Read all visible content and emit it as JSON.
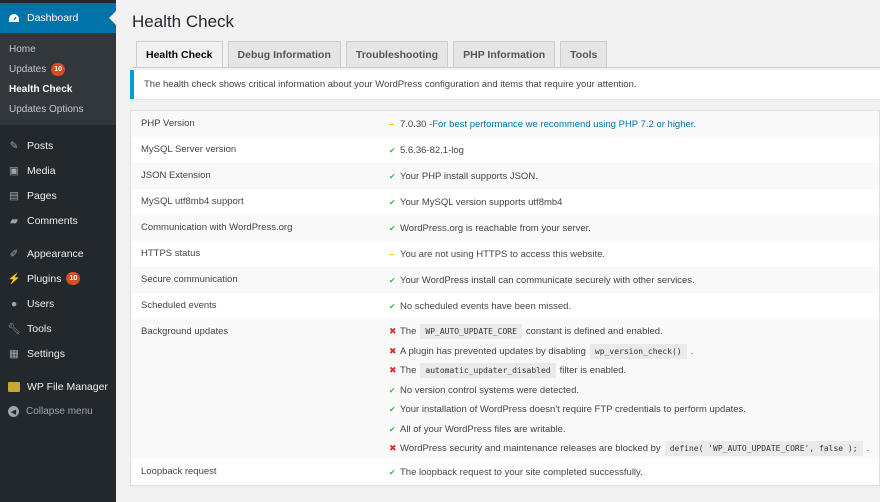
{
  "sidebar": {
    "dashboard": "Dashboard",
    "submenu": [
      {
        "label": "Home"
      },
      {
        "label": "Updates",
        "badge": "10"
      },
      {
        "label": "Health Check",
        "current": true
      },
      {
        "label": "Updates Options"
      }
    ],
    "items": [
      {
        "label": "Posts",
        "icon": "pin-icon"
      },
      {
        "label": "Media",
        "icon": "media-icon"
      },
      {
        "label": "Pages",
        "icon": "pages-icon"
      },
      {
        "label": "Comments",
        "icon": "comment-icon"
      },
      {
        "label": "Appearance",
        "icon": "brush-icon"
      },
      {
        "label": "Plugins",
        "icon": "plugin-icon",
        "badge": "10"
      },
      {
        "label": "Users",
        "icon": "user-icon"
      },
      {
        "label": "Tools",
        "icon": "wrench-icon"
      },
      {
        "label": "Settings",
        "icon": "settings-icon"
      },
      {
        "label": "WP File Manager",
        "icon": "folder-icon"
      }
    ],
    "collapse": "Collapse menu"
  },
  "page": {
    "title": "Health Check",
    "tabs": [
      "Health Check",
      "Debug Information",
      "Troubleshooting",
      "PHP Information",
      "Tools"
    ],
    "notice": "The health check shows critical information about your WordPress configuration and items that require your attention."
  },
  "checks": [
    {
      "label": "PHP Version",
      "status": "warning",
      "value": "7.0.30 - ",
      "link": "For best performance we recommend using PHP 7.2 or higher."
    },
    {
      "label": "MySQL Server version",
      "status": "good",
      "value": "5.6.36-82.1-log"
    },
    {
      "label": "JSON Extension",
      "status": "good",
      "value": "Your PHP install supports JSON."
    },
    {
      "label": "MySQL utf8mb4 support",
      "status": "good",
      "value": "Your MySQL version supports utf8mb4"
    },
    {
      "label": "Communication with WordPress.org",
      "status": "good",
      "value": "WordPress.org is reachable from your server."
    },
    {
      "label": "HTTPS status",
      "status": "warning",
      "value": "You are not using HTTPS to access this website."
    },
    {
      "label": "Secure communication",
      "status": "good",
      "value": "Your WordPress install can communicate securely with other services."
    },
    {
      "label": "Scheduled events",
      "status": "good",
      "value": "No scheduled events have been missed."
    }
  ],
  "background_updates": {
    "label": "Background updates",
    "lines": [
      {
        "status": "error",
        "pre": "The",
        "code": "WP_AUTO_UPDATE_CORE",
        "post": "constant is defined and enabled."
      },
      {
        "status": "error",
        "pre": "A plugin has prevented updates by disabling",
        "code": "wp_version_check()",
        "post": "."
      },
      {
        "status": "error",
        "pre": "The",
        "code": "automatic_updater_disabled",
        "post": "filter is enabled."
      },
      {
        "status": "good",
        "pre": "No version control systems were detected."
      },
      {
        "status": "good",
        "pre": "Your installation of WordPress doesn't require FTP credentials to perform updates."
      },
      {
        "status": "good",
        "pre": "All of your WordPress files are writable."
      },
      {
        "status": "error",
        "pre": "WordPress security and maintenance releases are blocked by",
        "code": "define( 'WP_AUTO_UPDATE_CORE', false );",
        "post": "."
      }
    ]
  },
  "loopback": {
    "label": "Loopback request",
    "status": "good",
    "value": "The loopback request to your site completed successfully."
  },
  "colors": {
    "accent": "#0073aa",
    "good": "#46b450",
    "warning": "#ffb900",
    "error": "#dc3232",
    "badge": "#d54e21"
  }
}
